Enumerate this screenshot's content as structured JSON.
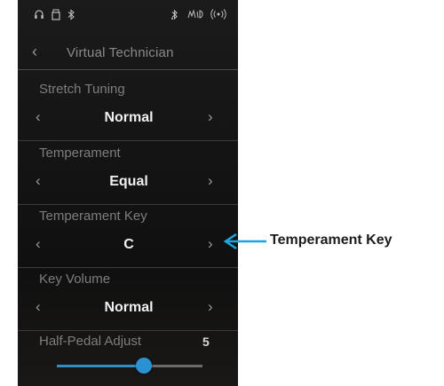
{
  "header": {
    "title": "Virtual Technician"
  },
  "settings": [
    {
      "label": "Stretch Tuning",
      "value": "Normal"
    },
    {
      "label": "Temperament",
      "value": "Equal"
    },
    {
      "label": "Temperament Key",
      "value": "C"
    },
    {
      "label": "Key Volume",
      "value": "Normal"
    }
  ],
  "half_pedal": {
    "label": "Half-Pedal Adjust",
    "value": "5",
    "level_fraction": 0.6
  },
  "callout": {
    "text": "Temperament Key"
  },
  "colors": {
    "accent": "#2a92d2",
    "callout": "#1aa7e0",
    "background": "#141414"
  },
  "status_icons": [
    "headphones-icon",
    "usb-memory-icon",
    "bluetooth-icon",
    "audio-bluetooth-icon",
    "midi-icon",
    "wireless-lan-icon"
  ]
}
